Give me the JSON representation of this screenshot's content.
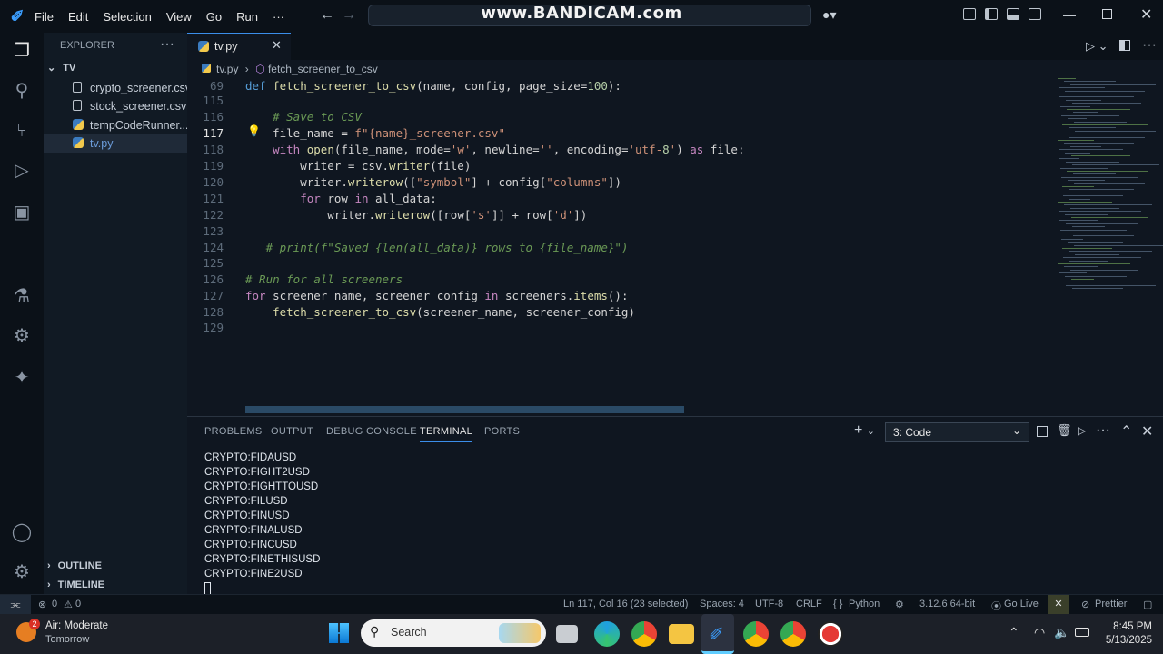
{
  "titlebar": {
    "menus": [
      "File",
      "Edit",
      "Selection",
      "View",
      "Go",
      "Run",
      "···"
    ],
    "watermark": "www.BANDICAM.com"
  },
  "sidebar": {
    "title": "EXPLORER",
    "folder": "TV",
    "files": [
      "crypto_screener.csv",
      "stock_screener.csv",
      "tempCodeRunner...",
      "tv.py"
    ],
    "outline": "OUTLINE",
    "timeline": "TIMELINE"
  },
  "editor": {
    "tab": "tv.py",
    "breadcrumb_file": "tv.py",
    "breadcrumb_symbol": "fetch_screener_to_csv",
    "lines": [
      {
        "n": "69",
        "t": "def fetch_screener_to_csv(name, config, page_size=100):"
      },
      {
        "n": "115",
        "t": ""
      },
      {
        "n": "116",
        "t": "    # Save to CSV"
      },
      {
        "n": "117",
        "t": "    file_name = f\"{name}_screener.csv\""
      },
      {
        "n": "118",
        "t": "    with open(file_name, mode='w', newline='', encoding='utf-8') as file:"
      },
      {
        "n": "119",
        "t": "        writer = csv.writer(file)"
      },
      {
        "n": "120",
        "t": "        writer.writerow([\"symbol\"] + config[\"columns\"])"
      },
      {
        "n": "121",
        "t": "        for row in all_data:"
      },
      {
        "n": "122",
        "t": "            writer.writerow([row['s']] + row['d'])"
      },
      {
        "n": "123",
        "t": ""
      },
      {
        "n": "124",
        "t": "   # print(f\"Saved {len(all_data)} rows to {file_name}\")"
      },
      {
        "n": "125",
        "t": ""
      },
      {
        "n": "126",
        "t": "# Run for all screeners"
      },
      {
        "n": "127",
        "t": "for screener_name, screener_config in screeners.items():"
      },
      {
        "n": "128",
        "t": "    fetch_screener_to_csv(screener_name, screener_config)"
      },
      {
        "n": "129",
        "t": ""
      }
    ]
  },
  "panel": {
    "tabs": [
      "PROBLEMS",
      "OUTPUT",
      "DEBUG CONSOLE",
      "TERMINAL",
      "PORTS"
    ],
    "active_tab": "TERMINAL",
    "terminal_select": "3: Code",
    "output": [
      "CRYPTO:FIDAUSD",
      "CRYPTO:FIGHT2USD",
      "CRYPTO:FIGHTTOUSD",
      "CRYPTO:FILUSD",
      "CRYPTO:FINUSD",
      "CRYPTO:FINALUSD",
      "CRYPTO:FINCUSD",
      "CRYPTO:FINETHISUSD",
      "CRYPTO:FINE2USD"
    ]
  },
  "status": {
    "errors": "0",
    "warnings": "0",
    "position": "Ln 117, Col 16 (23 selected)",
    "spaces": "Spaces: 4",
    "encoding": "UTF-8",
    "eol": "CRLF",
    "language": "Python",
    "interpreter": "3.12.6 64-bit",
    "golive": "Go Live",
    "prettier": "Prettier"
  },
  "taskbar": {
    "weather_badge": "2",
    "weather_title": "Air: Moderate",
    "weather_sub": "Tomorrow",
    "search": "Search",
    "time": "8:45 PM",
    "date": "5/13/2025"
  },
  "colors": {
    "accent": "#3b8eea",
    "bg": "#0f1620",
    "keyword": "#c586c0",
    "function": "#dcdcaa",
    "string": "#ce9178",
    "comment": "#6a9955"
  }
}
